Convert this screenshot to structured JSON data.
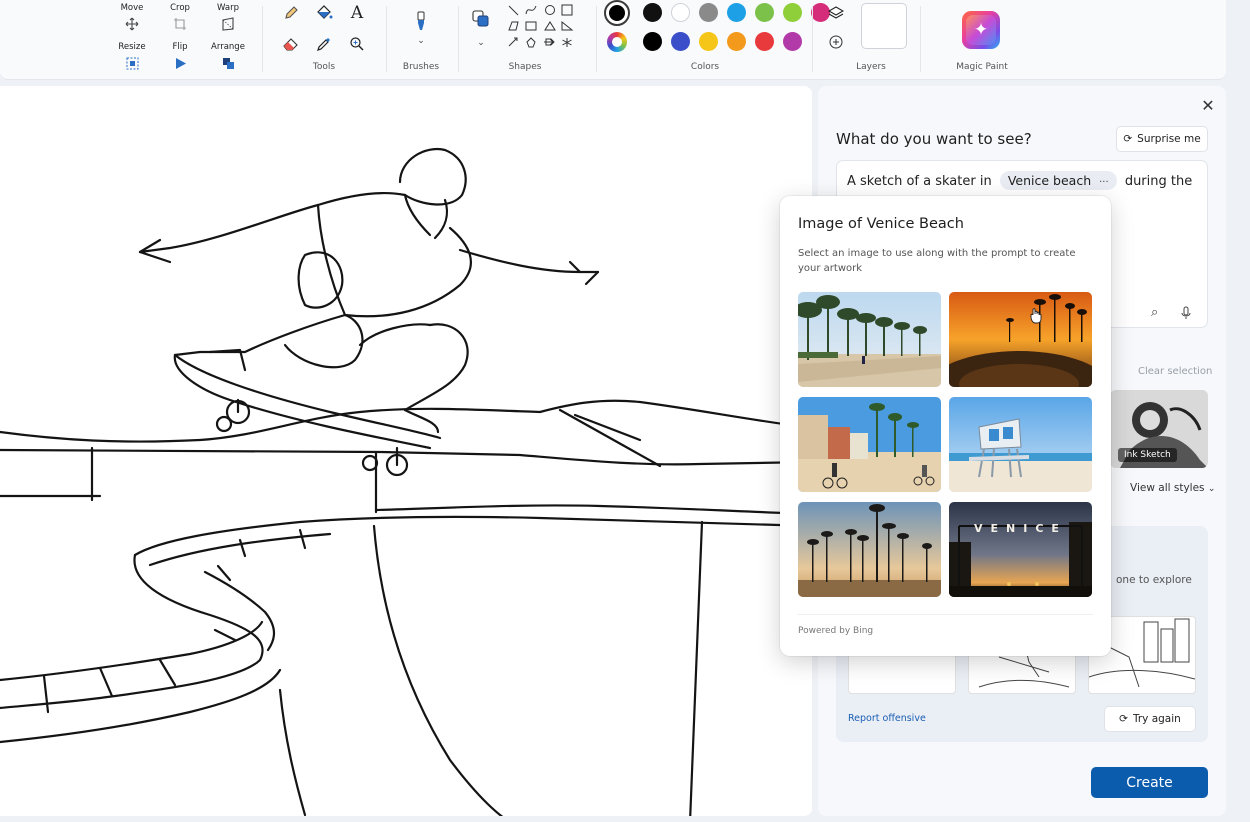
{
  "toolbar": {
    "image_tools": {
      "move": "Move",
      "crop": "Crop",
      "warp": "Warp",
      "resize": "Resize",
      "flip": "Flip",
      "arrange": "Arrange"
    },
    "groups": {
      "tools": "Tools",
      "brushes": "Brushes",
      "shapes": "Shapes",
      "colors": "Colors",
      "layers": "Layers",
      "magic_paint": "Magic Paint"
    },
    "colors_row1": [
      "#111111",
      "#ffffff",
      "#8a8a8a",
      "#1ea0e6",
      "#7cc24a",
      "#8fcf3a",
      "#d62d7a"
    ],
    "colors_row2": [
      "#000000",
      "#3a4ec9",
      "#f5c518",
      "#f39a1c",
      "#e8393d",
      "#b23aa8"
    ],
    "icons": {
      "move": "move-icon",
      "crop": "crop-icon",
      "warp": "warp-icon",
      "resize": "resize-icon",
      "flip": "flip-icon",
      "arrange": "arrange-icon",
      "pencil": "pencil-icon",
      "fill": "fill-bucket-icon",
      "text": "text-icon",
      "eraser": "eraser-icon",
      "picker": "color-picker-icon",
      "zoom": "magnifier-icon",
      "brush": "brush-icon",
      "layers": "layers-icon",
      "add": "plus-icon"
    }
  },
  "panel": {
    "title": "What do you want to see?",
    "surprise_label": "Surprise me",
    "prompt_prefix": "A sketch of a skater in",
    "prompt_chip": "Venice beach",
    "prompt_chip_more": "···",
    "prompt_suffix": "during the",
    "clear_selection": "Clear selection",
    "style_caption": "Ink Sketch",
    "view_all_styles": "View all styles",
    "explore_text": "one to explore",
    "report_offensive": "Report offensive",
    "try_again": "Try again",
    "create": "Create"
  },
  "popup": {
    "title": "Image of Venice Beach",
    "description": "Select an image to use along with the prompt to create your artwork",
    "powered_by": "Powered by Bing",
    "venice_sign": "VENICE"
  }
}
